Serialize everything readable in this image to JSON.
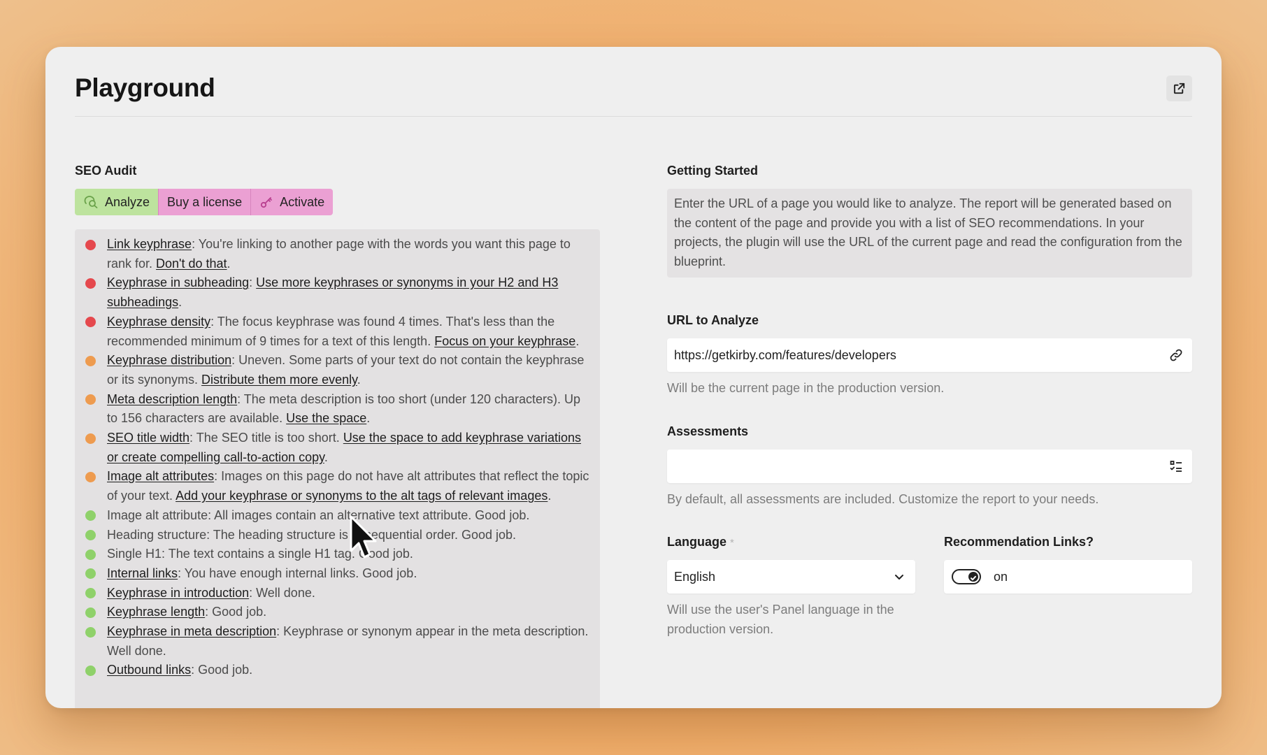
{
  "header": {
    "title": "Playground",
    "open_icon": "external-link-icon"
  },
  "seo_audit": {
    "label": "SEO Audit",
    "buttons": [
      {
        "label": "Analyze",
        "icon": "analyze-search-icon",
        "color": "#bde39e"
      },
      {
        "label": "Buy a license",
        "color": "#eba0d3"
      },
      {
        "label": "Activate",
        "icon": "key-icon",
        "color": "#eba0d3"
      }
    ],
    "items": [
      {
        "status": "red",
        "title": "Link keyphrase",
        "text": ": You're linking to another page with the words you want this page to rank for. ",
        "link": "Don't do that",
        "end": "."
      },
      {
        "status": "red",
        "title": "Keyphrase in subheading",
        "text": ": ",
        "link": "Use more keyphrases or synonyms in your H2 and H3 subheadings",
        "end": "."
      },
      {
        "status": "red",
        "title": "Keyphrase density",
        "text": ": The focus keyphrase was found 4 times. That's less than the recommended minimum of 9 times for a text of this length. ",
        "link": "Focus on your keyphrase",
        "end": "."
      },
      {
        "status": "orange",
        "title": "Keyphrase distribution",
        "text": ": Uneven. Some parts of your text do not contain the keyphrase or its synonyms. ",
        "link": "Distribute them more evenly",
        "end": "."
      },
      {
        "status": "orange",
        "title": "Meta description length",
        "text": ": The meta description is too short (under 120 characters). Up to 156 characters are available. ",
        "link": "Use the space",
        "end": "."
      },
      {
        "status": "orange",
        "title": "SEO title width",
        "text": ": The SEO title is too short. ",
        "link": "Use the space to add keyphrase variations or create compelling call-to-action copy",
        "end": "."
      },
      {
        "status": "orange",
        "title": "Image alt attributes",
        "text": ": Images on this page do not have alt attributes that reflect the topic of your text. ",
        "link": "Add your keyphrase or synonyms to the alt tags of relevant images",
        "end": "."
      },
      {
        "status": "green",
        "title": "",
        "text": "Image alt attribute: All images contain an alternative text attribute. Good job.",
        "link": "",
        "end": ""
      },
      {
        "status": "green",
        "title": "",
        "text": "Heading structure: The heading structure is in sequential order. Good job.",
        "link": "",
        "end": ""
      },
      {
        "status": "green",
        "title": "",
        "text": "Single H1: The text contains a single H1 tag. Good job.",
        "link": "",
        "end": ""
      },
      {
        "status": "green",
        "title": "Internal links",
        "text": ": You have enough internal links. Good job.",
        "link": "",
        "end": ""
      },
      {
        "status": "green",
        "title": "Keyphrase in introduction",
        "text": ": Well done.",
        "link": "",
        "end": ""
      },
      {
        "status": "green",
        "title": "Keyphrase length",
        "text": ": Good job.",
        "link": "",
        "end": ""
      },
      {
        "status": "green",
        "title": "Keyphrase in meta description",
        "text": ": Keyphrase or synonym appear in the meta description. Well done.",
        "link": "",
        "end": ""
      },
      {
        "status": "green",
        "title": "Outbound links",
        "text": ": Good job.",
        "link": "",
        "end": ""
      }
    ]
  },
  "getting_started": {
    "label": "Getting Started",
    "text": "Enter the URL of a page you would like to analyze. The report will be generated based on the content of the page and provide you with a list of SEO recommendations. In your projects, the plugin will use the URL of the current page and read the configuration from the blueprint."
  },
  "url_field": {
    "label": "URL to Analyze",
    "value": "https://getkirby.com/features/developers",
    "help": "Will be the current page in the production version.",
    "icon": "link-icon"
  },
  "assessments": {
    "label": "Assessments",
    "value": "",
    "help": "By default, all assessments are included. Customize the report to your needs.",
    "icon": "checklist-icon"
  },
  "language": {
    "label": "Language",
    "required_mark": "*",
    "value": "English",
    "help": "Will use the user's Panel language in the production version.",
    "icon": "chevron-down-icon"
  },
  "recommendation_links": {
    "label": "Recommendation Links?",
    "state_label": "on",
    "on": true
  },
  "colors": {
    "status_red": "#e5484d",
    "status_orange": "#ee9b4f",
    "status_green": "#8fd16a",
    "background": "#f3a862"
  }
}
